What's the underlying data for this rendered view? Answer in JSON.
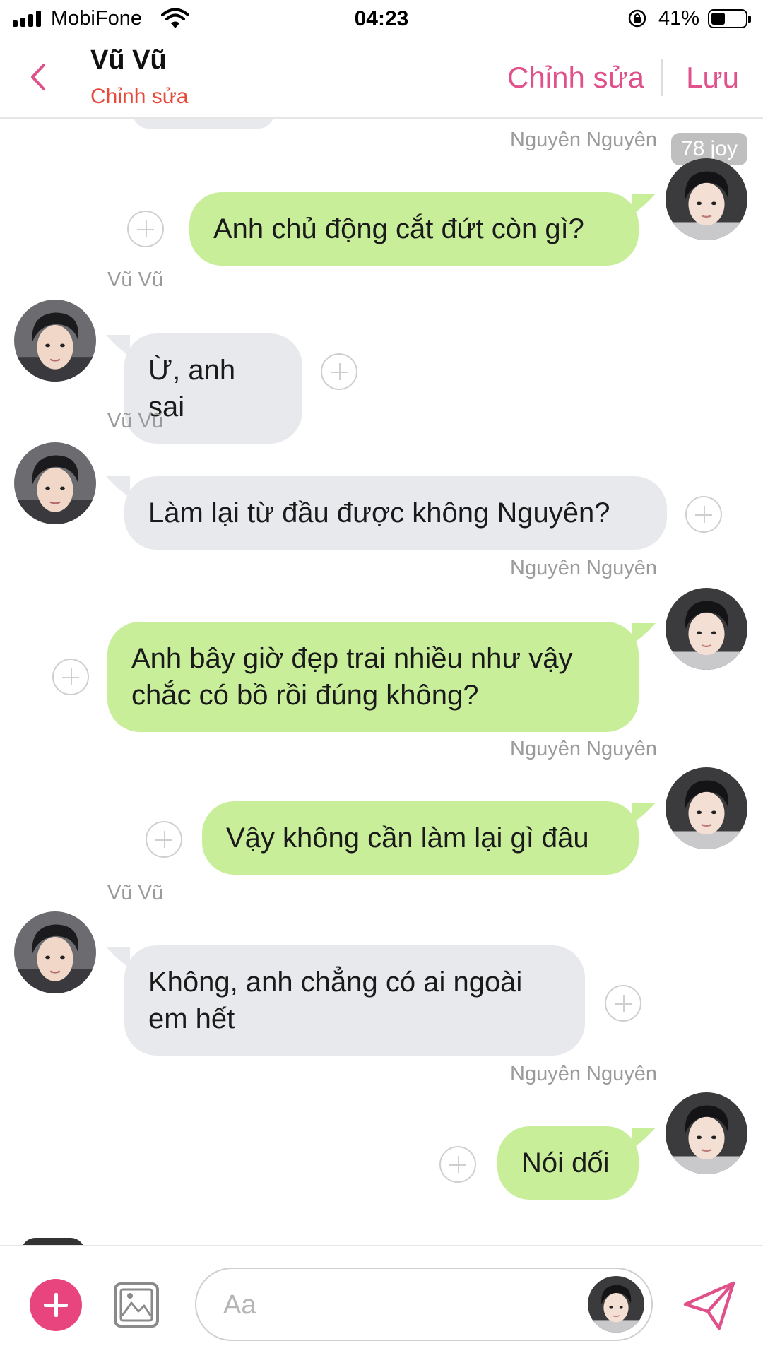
{
  "status_bar": {
    "carrier": "MobiFone",
    "time": "04:23",
    "battery_percent": "41%"
  },
  "header": {
    "contact_name": "Vũ Vũ",
    "contact_subtitle": "Chỉnh sửa",
    "edit_label": "Chỉnh sửa",
    "save_label": "Lưu"
  },
  "badge": "78 joy",
  "messages": [
    {
      "direction": "out",
      "sender": "Nguyên Nguyên",
      "text": "Anh chủ động cắt đứt còn gì?"
    },
    {
      "direction": "in",
      "sender": "Vũ Vũ",
      "text": "Ừ, anh sai"
    },
    {
      "direction": "in",
      "sender": "Vũ Vũ",
      "text": "Làm lại từ đầu được không Nguyên?"
    },
    {
      "direction": "out",
      "sender": "Nguyên Nguyên",
      "text": "Anh bây giờ đẹp trai nhiều như vậy chắc có bồ rồi đúng không?"
    },
    {
      "direction": "out",
      "sender": "Nguyên Nguyên",
      "text": "Vậy không cần làm lại gì đâu"
    },
    {
      "direction": "in",
      "sender": "Vũ Vũ",
      "text": "Không, anh chẳng có ai ngoài em hết"
    },
    {
      "direction": "out",
      "sender": "Nguyên Nguyên",
      "text": "Nói dối"
    }
  ],
  "input": {
    "placeholder": "Aa"
  },
  "colors": {
    "accent_pink": "#e0508a",
    "subtitle_red": "#e8493a",
    "outgoing_bubble": "#c8ee9a",
    "incoming_bubble": "#e8e9ec"
  }
}
